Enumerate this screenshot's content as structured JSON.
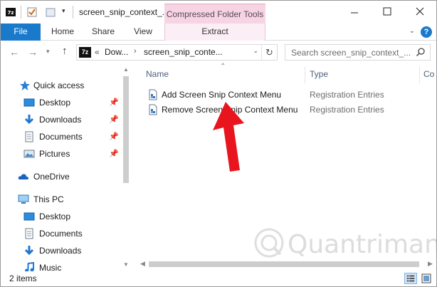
{
  "window": {
    "title": "screen_snip_context_...",
    "context_tab_title": "Compressed Folder Tools"
  },
  "ribbon": {
    "file": "File",
    "tabs": [
      "Home",
      "Share",
      "View",
      "Extract"
    ]
  },
  "address": {
    "icon_label": "7z",
    "overflow": "«",
    "crumbs": [
      "Dow...",
      "screen_snip_conte..."
    ]
  },
  "search": {
    "placeholder": "Search screen_snip_context_..."
  },
  "nav": {
    "quick_access": "Quick access",
    "quick_items": [
      "Desktop",
      "Downloads",
      "Documents",
      "Pictures"
    ],
    "onedrive": "OneDrive",
    "this_pc": "This PC",
    "pc_items": [
      "Desktop",
      "Documents",
      "Downloads",
      "Music"
    ]
  },
  "columns": {
    "name": "Name",
    "type": "Type",
    "third": "Co"
  },
  "files": [
    {
      "name": "Add Screen Snip Context Menu",
      "type": "Registration Entries"
    },
    {
      "name": "Remove Screen Snip Context Menu",
      "type": "Registration Entries"
    }
  ],
  "status": {
    "count": "2 items"
  },
  "watermark": {
    "text": "Quantrimang"
  },
  "colors": {
    "accent": "#1979ca",
    "context_tab": "#f6d4e4",
    "arrow": "#e8151e"
  }
}
